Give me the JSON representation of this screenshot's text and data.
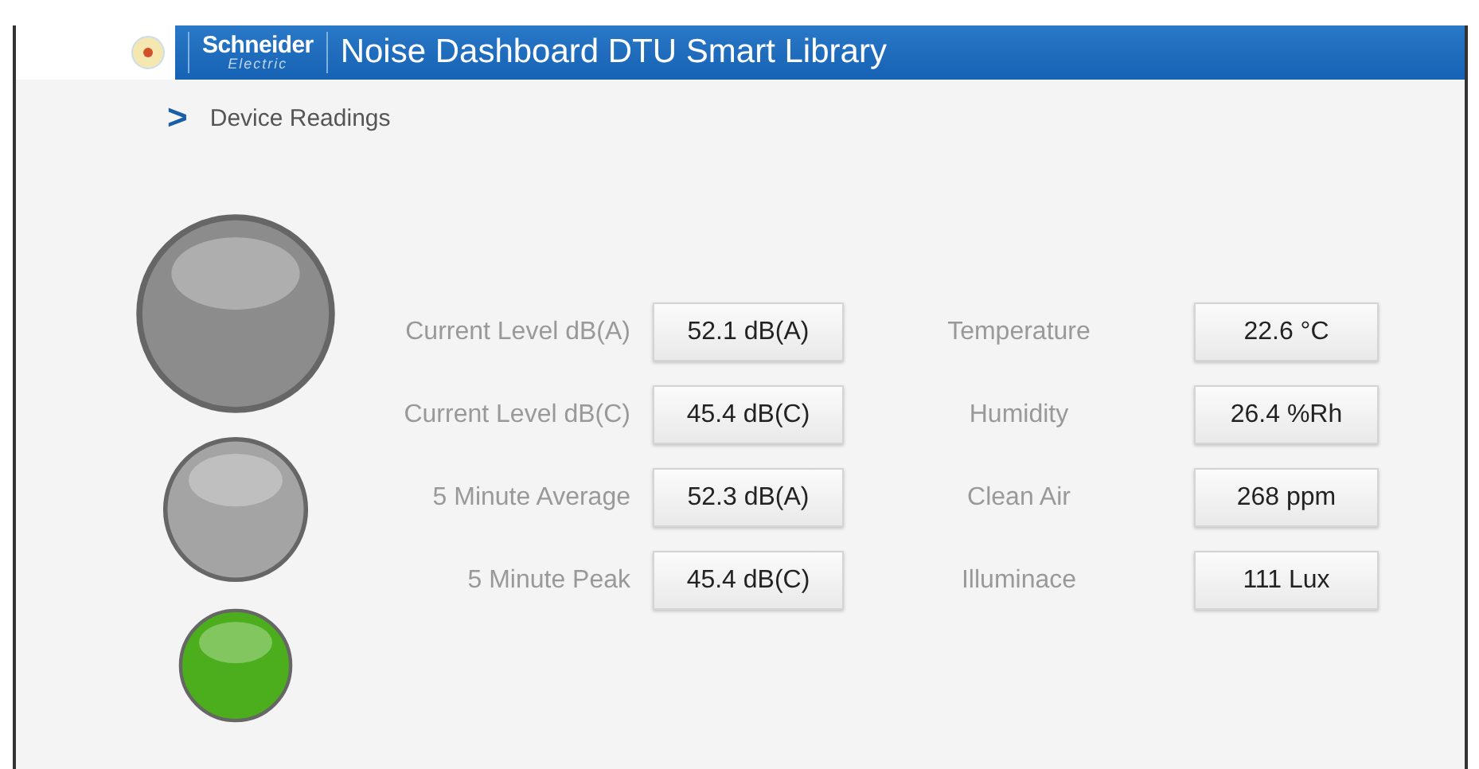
{
  "header": {
    "brand_name": "Schneider",
    "brand_sub": "Electric",
    "title": "Noise Dashboard DTU Smart Library"
  },
  "breadcrumb": {
    "icon": ">",
    "label": "Device Readings"
  },
  "lights": [
    {
      "color": "#8c8c8c"
    },
    {
      "color": "#a4a4a4"
    },
    {
      "color": "#4cae1c"
    }
  ],
  "readings": [
    {
      "label": "Current Level dB(A)",
      "value": "52.1 dB(A)",
      "env_label": "Temperature",
      "env_value": "22.6 °C"
    },
    {
      "label": "Current Level dB(C)",
      "value": "45.4 dB(C)",
      "env_label": "Humidity",
      "env_value": "26.4 %Rh"
    },
    {
      "label": "5 Minute Average",
      "value": "52.3 dB(A)",
      "env_label": "Clean Air",
      "env_value": "268 ppm"
    },
    {
      "label": "5 Minute Peak",
      "value": "45.4 dB(C)",
      "env_label": "Illuminace",
      "env_value": "111 Lux"
    }
  ]
}
